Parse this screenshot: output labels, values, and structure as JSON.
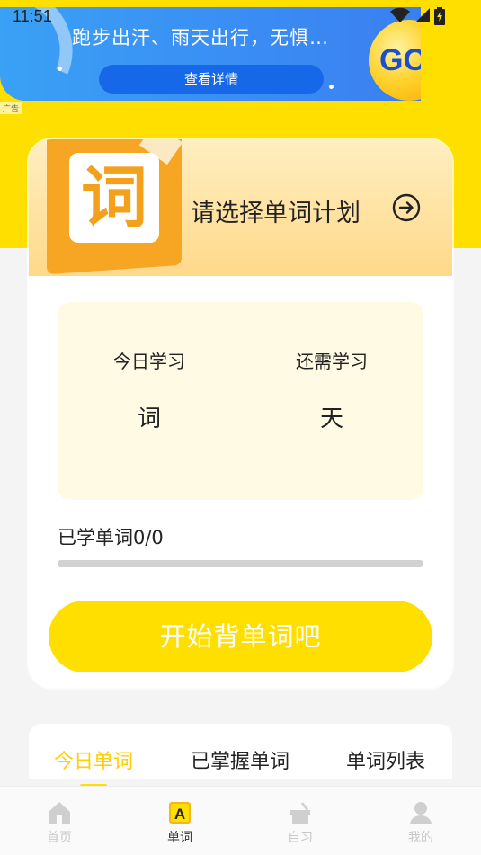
{
  "status_bar": {
    "time": "11:51"
  },
  "ad": {
    "title": "跑步出汗、雨天出行，无惧…",
    "button_label": "查看详情",
    "logo_text": "GO",
    "ad_label": "广告"
  },
  "plan_card": {
    "icon_char": "词",
    "title": "请选择单词计划",
    "today_label": "今日学习",
    "today_unit": "词",
    "remaining_label": "还需学习",
    "remaining_unit": "天",
    "learned_text": "已学单词0/0",
    "progress": 0,
    "start_button": "开始背单词吧"
  },
  "tabs": [
    "今日单词",
    "已掌握单词",
    "单词列表"
  ],
  "bottom_nav": [
    {
      "label": "首页",
      "icon": "home-icon"
    },
    {
      "label": "单词",
      "icon": "word-a-icon"
    },
    {
      "label": "自习",
      "icon": "desk-icon"
    },
    {
      "label": "我的",
      "icon": "profile-icon"
    }
  ],
  "colors": {
    "accent_yellow": "#ffdf00",
    "ad_blue": "#3a8ef4",
    "book_orange": "#f6a623"
  }
}
